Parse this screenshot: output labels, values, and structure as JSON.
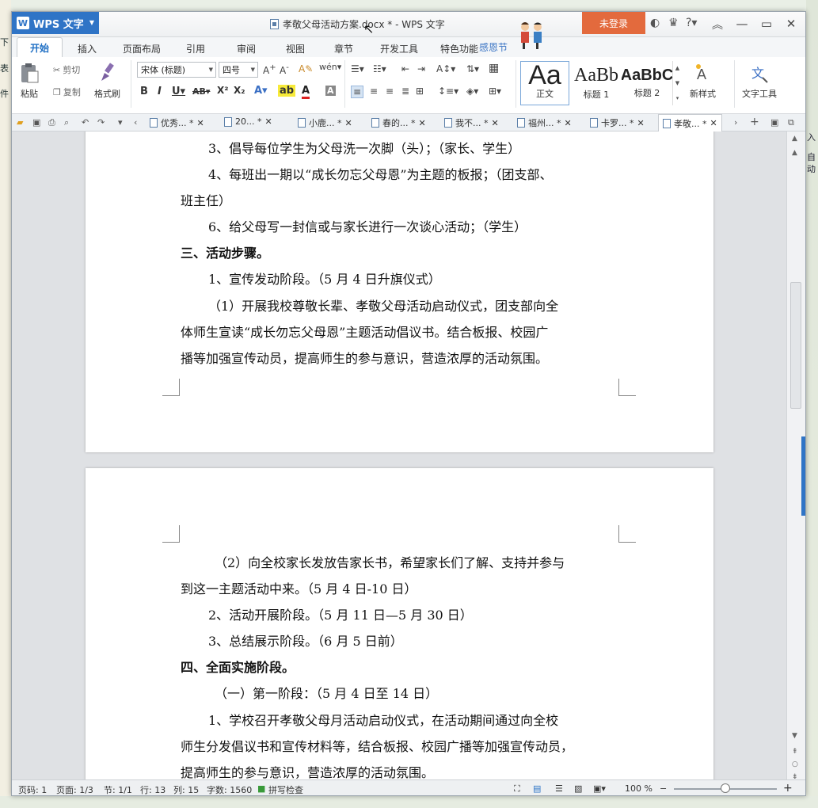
{
  "desktop": {
    "left_fragments": [
      "下",
      "表",
      "件"
    ],
    "right_fragments": [
      "入",
      "自",
      "动"
    ]
  },
  "titlebar": {
    "app_button": "WPS 文字",
    "doc_title": "孝敬父母活动方案.docx * - WPS 文字",
    "login_button": "未登录"
  },
  "menu": {
    "tabs": [
      "开始",
      "插入",
      "页面布局",
      "引用",
      "审阅",
      "视图",
      "章节",
      "开发工具",
      "特色功能"
    ],
    "festival": "感恩节"
  },
  "ribbon": {
    "paste": "粘贴",
    "cut": "剪切",
    "copy": "复制",
    "format_painter": "格式刷",
    "font_name": "宋体 (标题)",
    "font_size": "四号",
    "styles": [
      {
        "sample": "Aa",
        "name": "正文"
      },
      {
        "sample": "AaBb",
        "name": "标题 1"
      },
      {
        "sample": "AaBbC",
        "name": "标题 2"
      }
    ],
    "new_style": "新样式",
    "text_tools": "文字工具"
  },
  "doc_tabs": [
    "优秀... *",
    "20... *",
    "小鹿... *",
    "春的... *",
    "我不... *",
    "福州... *",
    "卡罗... *",
    "孝敬... *"
  ],
  "document": {
    "page1": [
      "3、倡导每位学生为父母洗一次脚（头）；（家长、学生）",
      "4、每班出一期以“成长勿忘父母恩”为主题的板报；（团支部、",
      "班主任）",
      "6、给父母写一封信或与家长进行一次谈心活动；（学生）",
      "三、活动步骤。",
      "1、宣传发动阶段。（5 月 4 日升旗仪式）",
      "（1）开展我校尊敬长辈、孝敬父母活动启动仪式，团支部向全",
      "体师生宣读“成长勿忘父母恩”主题活动倡议书。结合板报、校园广",
      "播等加强宣传动员，提高师生的参与意识，营造浓厚的活动氛围。"
    ],
    "page2": [
      "（2）向全校家长发放告家长书，希望家长们了解、支持并参与",
      "到这一主题活动中来。（5 月 4 日-10 日）",
      "2、活动开展阶段。（5 月 11 日—5 月 30 日）",
      "3、总结展示阶段。（6 月 5 日前）",
      "四、全面实施阶段。",
      "（一）第一阶段：（5 月 4 日至 14 日）",
      "1、学校召开孝敬父母月活动启动仪式，在活动期间通过向全校",
      "师生分发倡议书和宣传材料等，结合板报、校园广播等加强宣传动员，",
      "提高师生的参与意识，营造浓厚的活动氛围。"
    ]
  },
  "status": {
    "page_num": "页码: 1",
    "pages": "页面: 1/3",
    "section": "节: 1/1",
    "row": "行: 13",
    "col": "列: 15",
    "word_count": "字数: 1560",
    "spellcheck": "拼写检查",
    "zoom": "100 %"
  },
  "colors": {
    "accent": "#2f74c6",
    "login": "#e36a3d"
  }
}
